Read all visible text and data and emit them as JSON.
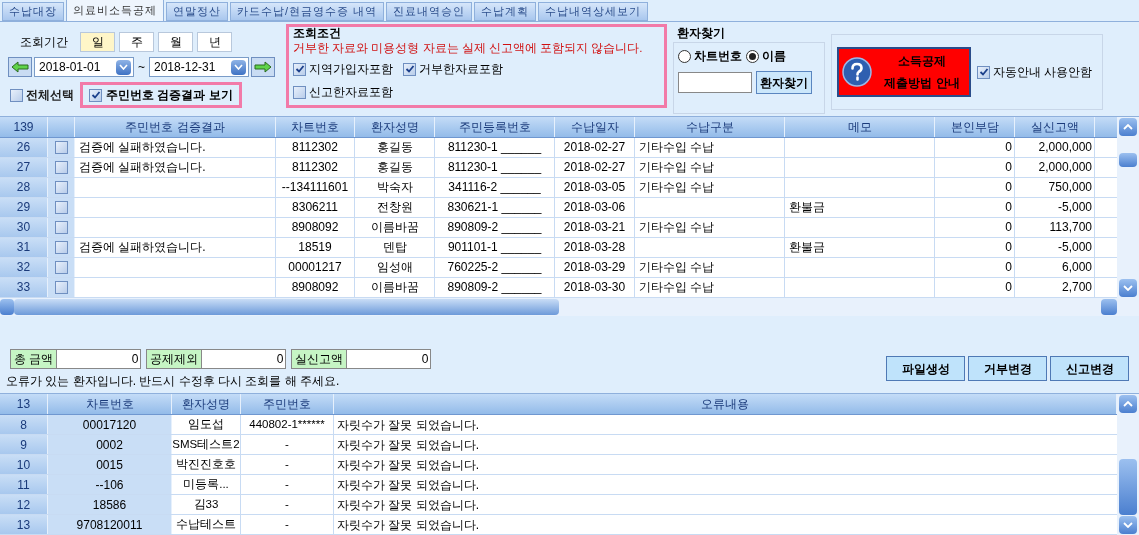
{
  "tabs": [
    {
      "label": "수납대장",
      "selected": false
    },
    {
      "label": "의료비소득공제",
      "selected": true
    },
    {
      "label": "연말정산",
      "selected": false
    },
    {
      "label": "카드수납/현금영수증 내역",
      "selected": false
    },
    {
      "label": "진료내역승인",
      "selected": false
    },
    {
      "label": "수납계획",
      "selected": false
    },
    {
      "label": "수납내역상세보기",
      "selected": false
    }
  ],
  "period": {
    "label": "조회기간",
    "units": [
      {
        "label": "일",
        "selected": true
      },
      {
        "label": "주",
        "selected": false
      },
      {
        "label": "월",
        "selected": false
      },
      {
        "label": "년",
        "selected": false
      }
    ],
    "date_from": "2018-01-01",
    "separator": "~",
    "date_to": "2018-12-31"
  },
  "select_all": {
    "label": "전체선택",
    "checked": false
  },
  "show_verification": {
    "label": "주민번호 검증결과 보기",
    "checked": true
  },
  "conditions": {
    "title": "조회조건",
    "warning": "거부한 자료와 미용성형 자료는 실제 신고액에 포함되지 않습니다.",
    "options": [
      {
        "label": "지역가입자포함",
        "checked": true
      },
      {
        "label": "거부한자료포함",
        "checked": true
      },
      {
        "label": "신고한자료포함",
        "checked": false
      }
    ]
  },
  "patient_search": {
    "title": "환자찾기",
    "radios": [
      {
        "label": "차트번호",
        "selected": false
      },
      {
        "label": "이름",
        "selected": true
      }
    ],
    "button": "환자찾기"
  },
  "guide_button": {
    "lines": [
      "소득공제",
      "제출방법 안내"
    ]
  },
  "auto_guide": {
    "label": "자동안내 사용안함",
    "checked": true
  },
  "upper_table": {
    "count": "139",
    "columns": [
      "주민번호 검증결과",
      "차트번호",
      "환자성명",
      "주민등록번호",
      "수납일자",
      "수납구분",
      "메모",
      "본인부담",
      "실신고액"
    ],
    "rows": [
      {
        "number": "26",
        "checked": false,
        "cells": [
          "검증에 실패하였습니다.",
          "8112302",
          "홍길동",
          "811230-1 ______",
          "2018-02-27",
          "기타수입 수납",
          "",
          "0",
          "2,000,000"
        ]
      },
      {
        "number": "27",
        "checked": false,
        "cells": [
          "검증에 실패하였습니다.",
          "8112302",
          "홍길동",
          "811230-1 ______",
          "2018-02-27",
          "기타수입 수납",
          "",
          "0",
          "2,000,000"
        ]
      },
      {
        "number": "28",
        "checked": false,
        "cells": [
          "",
          "--134111601",
          "박숙자",
          "341116-2 ______",
          "2018-03-05",
          "기타수입 수납",
          "",
          "0",
          "750,000"
        ]
      },
      {
        "number": "29",
        "checked": false,
        "cells": [
          "",
          "8306211",
          "전창원",
          "830621-1 ______",
          "2018-03-06",
          "",
          "환불금",
          "0",
          "-5,000"
        ]
      },
      {
        "number": "30",
        "checked": false,
        "cells": [
          "",
          "8908092",
          "이름바꿈",
          "890809-2 ______",
          "2018-03-21",
          "기타수입 수납",
          "",
          "0",
          "113,700"
        ]
      },
      {
        "number": "31",
        "checked": false,
        "cells": [
          "검증에 실패하였습니다.",
          "18519",
          "덴탑",
          "901101-1 ______",
          "2018-03-28",
          "",
          "환불금",
          "0",
          "-5,000"
        ]
      },
      {
        "number": "32",
        "checked": false,
        "cells": [
          "",
          "00001217",
          "임성애",
          "760225-2 ______",
          "2018-03-29",
          "기타수입 수납",
          "",
          "0",
          "6,000"
        ]
      },
      {
        "number": "33",
        "checked": false,
        "cells": [
          "",
          "8908092",
          "이름바꿈",
          "890809-2 ______",
          "2018-03-30",
          "기타수입 수납",
          "",
          "0",
          "2,700"
        ]
      }
    ]
  },
  "totals": [
    {
      "label": "총 금액",
      "value": "0"
    },
    {
      "label": "공제제외",
      "value": "0"
    },
    {
      "label": "실신고액",
      "value": "0"
    }
  ],
  "message": "오류가 있는 환자입니다. 반드시 수정후 다시 조회를 해 주세요.",
  "actions": [
    "파일생성",
    "거부변경",
    "신고변경"
  ],
  "error_table": {
    "count": "13",
    "columns": [
      "차트번호",
      "환자성명",
      "주민번호",
      "오류내용"
    ],
    "rows": [
      {
        "number": "8",
        "cells": [
          "00017120",
          "임도섭",
          "440802-1******",
          "자릿수가 잘못 되었습니다."
        ]
      },
      {
        "number": "9",
        "cells": [
          "0002",
          "SMS테스트2",
          "-",
          "자릿수가 잘못 되었습니다."
        ]
      },
      {
        "number": "10",
        "cells": [
          "0015",
          "박진진호호",
          "-",
          "자릿수가 잘못 되었습니다."
        ]
      },
      {
        "number": "11",
        "cells": [
          "--106",
          "미등록...",
          "-",
          "자릿수가 잘못 되었습니다."
        ]
      },
      {
        "number": "12",
        "cells": [
          "18586",
          "김33",
          "-",
          "자릿수가 잘못 되었습니다."
        ]
      },
      {
        "number": "13",
        "cells": [
          "9708120011",
          "수납테스트",
          "-",
          "자릿수가 잘못 되었습니다."
        ]
      }
    ]
  }
}
